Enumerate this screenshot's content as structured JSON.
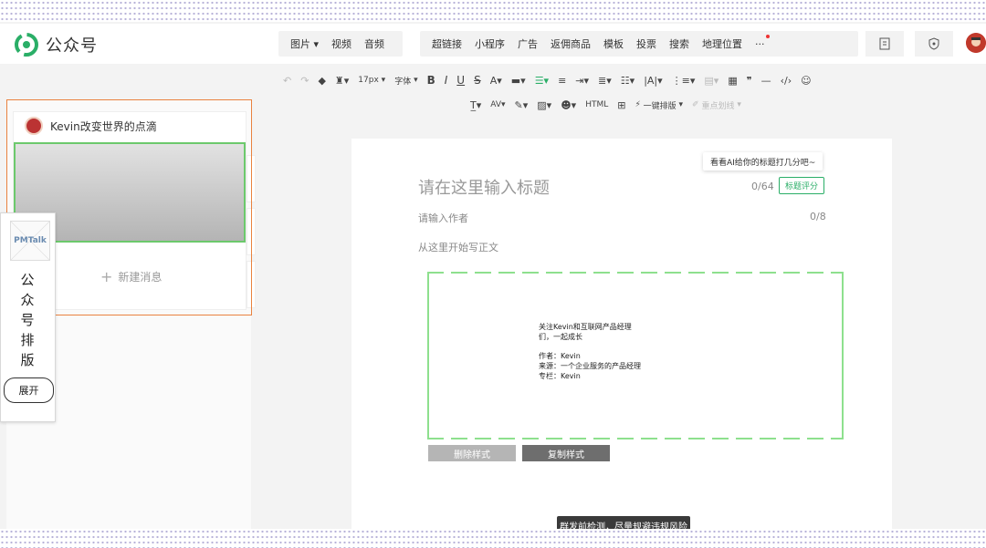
{
  "brand": {
    "name": "公众号"
  },
  "nav": {
    "group1": [
      "图片",
      "视频",
      "音频"
    ],
    "group2": [
      "超链接",
      "小程序",
      "广告",
      "返佣商品",
      "模板",
      "投票",
      "搜索",
      "地理位置"
    ],
    "more": "···"
  },
  "toolbar": {
    "font_size": "17px",
    "font_family": "字体",
    "one_click_layout": "一键排版",
    "highlight": "重点划线"
  },
  "left": {
    "account_name": "Kevin改变世界的点滴",
    "new_message": "新建消息"
  },
  "pmtalk": {
    "logo_text": "PMTalk",
    "title": "公众号排版",
    "expand_button": "展开"
  },
  "editor": {
    "ai_tip": "看看AI给你的标题打几分吧~",
    "title_placeholder": "请在这里输入标题",
    "title_count": "0/64",
    "title_score_button": "标题评分",
    "author_placeholder": "请输入作者",
    "author_count": "0/8",
    "body_placeholder": "从这里开始写正文"
  },
  "template": {
    "line1": "关注Kevin和互联网产品经理",
    "line2": "们，一起成长",
    "author": "作者：Kevin",
    "source": "来源：一个企业服务的产品经理",
    "column": "专栏：Kevin"
  },
  "buttons": {
    "delete_style": "删除样式",
    "copy_style": "复制样式"
  },
  "bottom_tip": "群发前检测，尽量规避违规风险",
  "colors": {
    "accent_green": "#2aae67",
    "orange_frame": "#e9823f",
    "dash_green": "#8ee08e"
  }
}
